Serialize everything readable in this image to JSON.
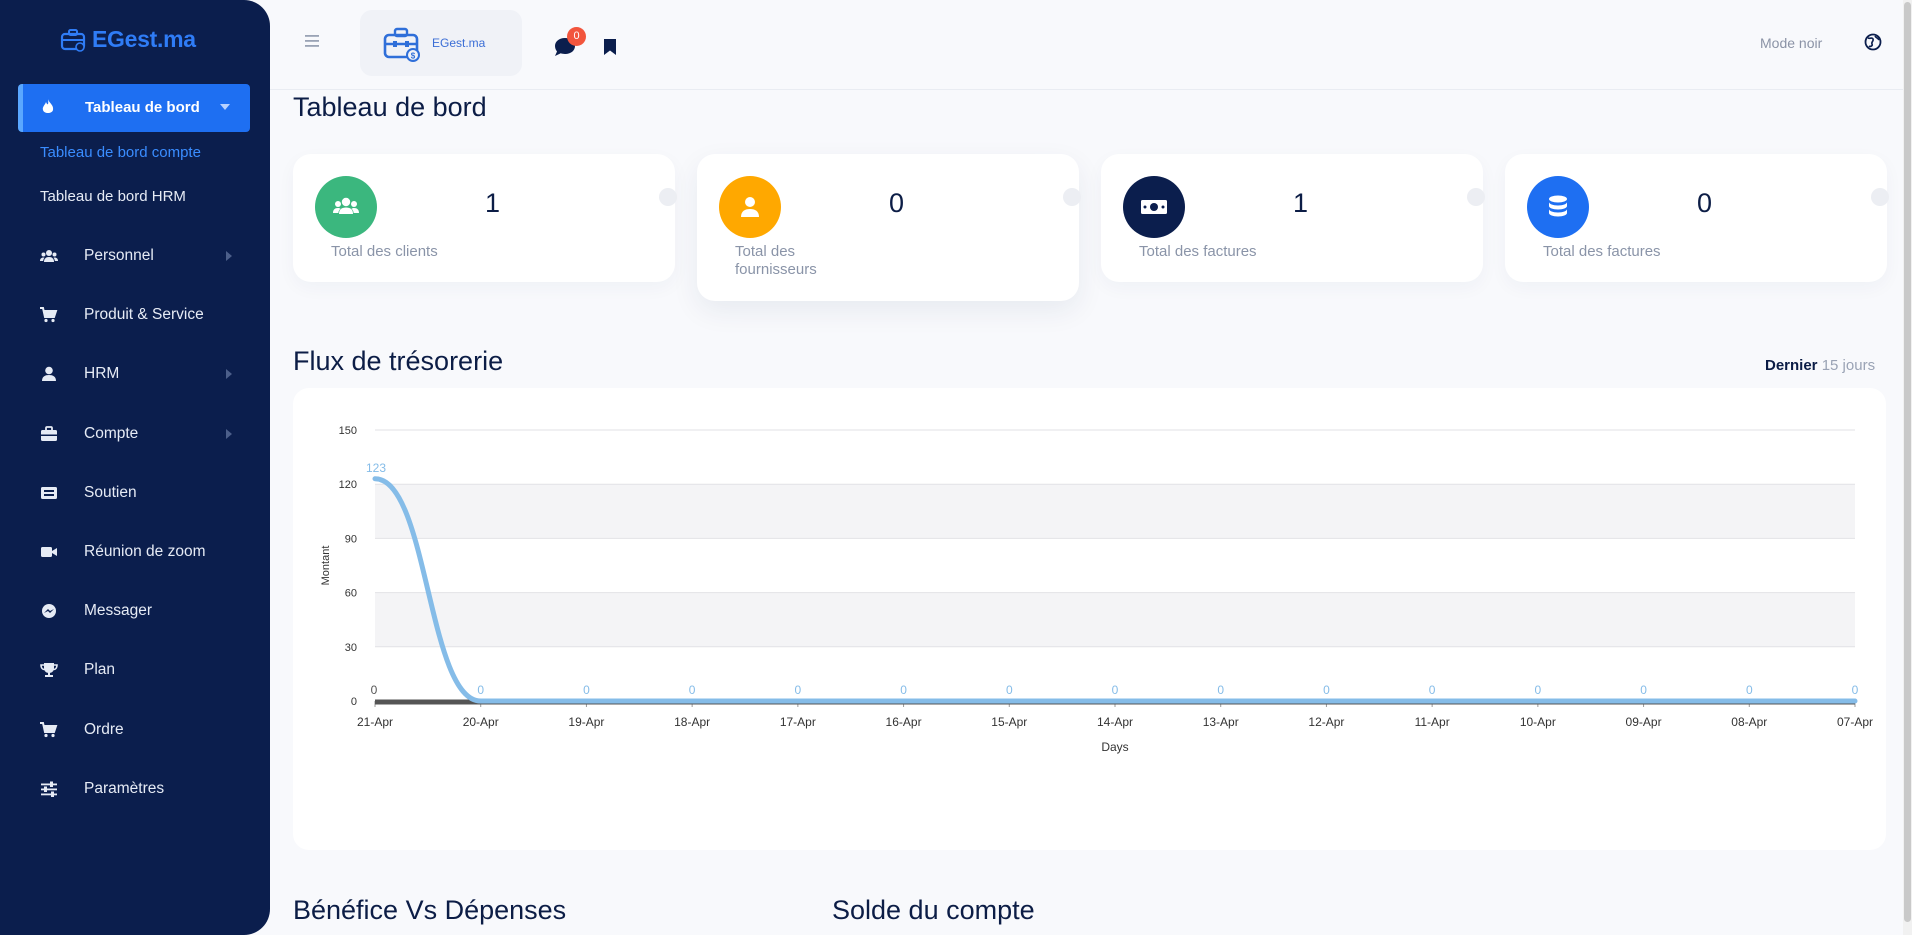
{
  "app": {
    "logo_text": "EGest.ma",
    "brand_text": "EGest.ma"
  },
  "sidebar": {
    "active": {
      "label": "Tableau de bord"
    },
    "sub_items": [
      {
        "label": "Tableau de bord compte",
        "color": "#3a8dff"
      },
      {
        "label": "Tableau de bord HRM",
        "color": "#e6ebf5"
      }
    ],
    "items": [
      {
        "label": "Personnel",
        "icon": "users-icon",
        "has_arrow": true
      },
      {
        "label": "Produit & Service",
        "icon": "cart-icon",
        "has_arrow": false
      },
      {
        "label": "HRM",
        "icon": "user-icon",
        "has_arrow": true
      },
      {
        "label": "Compte",
        "icon": "briefcase-icon",
        "has_arrow": true
      },
      {
        "label": "Soutien",
        "icon": "ticket-icon",
        "has_arrow": false
      },
      {
        "label": "Réunion de zoom",
        "icon": "video-icon",
        "has_arrow": false
      },
      {
        "label": "Messager",
        "icon": "messenger-icon",
        "has_arrow": false
      },
      {
        "label": "Plan",
        "icon": "trophy-icon",
        "has_arrow": false
      },
      {
        "label": "Ordre",
        "icon": "cart-icon",
        "has_arrow": false
      },
      {
        "label": "Paramètres",
        "icon": "sliders-icon",
        "has_arrow": false
      }
    ]
  },
  "topbar": {
    "notification_count": "0",
    "dark_mode_label": "Mode noir"
  },
  "page": {
    "title": "Tableau de bord"
  },
  "stats": [
    {
      "value": "1",
      "label": "Total des clients",
      "color": "#3bb77e",
      "icon": "users-icon"
    },
    {
      "value": "0",
      "label": "Total des fournisseurs",
      "color": "#ffa800",
      "icon": "user-icon"
    },
    {
      "value": "1",
      "label": "Total des factures",
      "color": "#0b1e4d",
      "icon": "money-icon"
    },
    {
      "value": "0",
      "label": "Total des factures",
      "color": "#1e6ff2",
      "icon": "database-icon"
    }
  ],
  "cashflow": {
    "title": "Flux de trésorerie",
    "range_prefix": "Dernier",
    "range_value": "15 jours"
  },
  "sections": {
    "profit_title": "Bénéfice Vs Dépenses",
    "balance_title": "Solde du compte"
  },
  "chart_data": {
    "type": "line",
    "categories": [
      "21-Apr",
      "20-Apr",
      "19-Apr",
      "18-Apr",
      "17-Apr",
      "16-Apr",
      "15-Apr",
      "14-Apr",
      "13-Apr",
      "12-Apr",
      "11-Apr",
      "10-Apr",
      "09-Apr",
      "08-Apr",
      "07-Apr"
    ],
    "series": [
      {
        "values": [
          123,
          0,
          0,
          0,
          0,
          0,
          0,
          0,
          0,
          0,
          0,
          0,
          0,
          0,
          0
        ],
        "color": "#85bce8"
      },
      {
        "values": [
          0,
          0,
          0,
          0,
          0,
          0,
          0,
          0,
          0,
          0,
          0,
          0,
          0,
          0,
          0
        ],
        "color": "#555555"
      }
    ],
    "xlabel": "Days",
    "ylabel": "Montant",
    "ylim": [
      0,
      150
    ],
    "yticks": [
      "0",
      "30",
      "60",
      "90",
      "120",
      "150"
    ],
    "grid": true
  }
}
